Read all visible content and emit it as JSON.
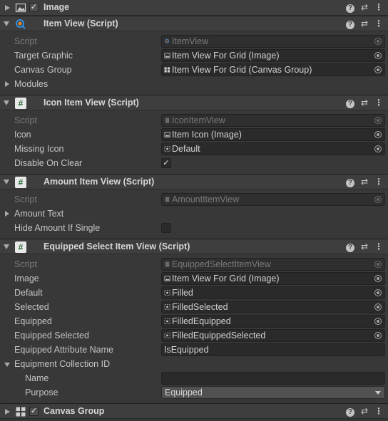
{
  "components": [
    {
      "title": "Image",
      "icon": "image-icon",
      "collapsed": true,
      "enabled": true
    },
    {
      "title": "Item View (Script)",
      "icon": "search-script-icon"
    },
    {
      "title": "Icon Item View (Script)",
      "icon": "script-icon"
    },
    {
      "title": "Amount Item View (Script)",
      "icon": "script-icon"
    },
    {
      "title": "Equipped Select Item View (Script)",
      "icon": "script-icon"
    },
    {
      "title": "Canvas Group",
      "icon": "canvas-group-icon",
      "collapsed": true,
      "enabled": true
    }
  ],
  "item_view": {
    "script_label": "Script",
    "script_value": "ItemView",
    "target_graphic_label": "Target Graphic",
    "target_graphic_value": "Item View For Grid (Image)",
    "canvas_group_label": "Canvas Group",
    "canvas_group_value": "Item View For Grid (Canvas Group)",
    "modules_label": "Modules"
  },
  "icon_item_view": {
    "script_label": "Script",
    "script_value": "IconItemView",
    "icon_label": "Icon",
    "icon_value": "Item Icon (Image)",
    "missing_icon_label": "Missing Icon",
    "missing_icon_value": "Default",
    "disable_on_clear_label": "Disable On Clear",
    "disable_on_clear_checked": true
  },
  "amount_item_view": {
    "script_label": "Script",
    "script_value": "AmountItemView",
    "amount_text_label": "Amount Text",
    "hide_amount_label": "Hide Amount If Single",
    "hide_amount_checked": false
  },
  "equipped_select_item_view": {
    "script_label": "Script",
    "script_value": "EquippedSelectItemView",
    "image_label": "Image",
    "image_value": "Item View For Grid (Image)",
    "default_label": "Default",
    "default_value": "Filled",
    "selected_label": "Selected",
    "selected_value": "FilledSelected",
    "equipped_label": "Equipped",
    "equipped_value": "FilledEquipped",
    "equipped_selected_label": "Equipped Selected",
    "equipped_selected_value": "FilledEquippedSelected",
    "equipped_attr_label": "Equipped Attribute Name",
    "equipped_attr_value": "IsEquipped",
    "collection_id_label": "Equipment Collection ID",
    "name_label": "Name",
    "name_value": "",
    "purpose_label": "Purpose",
    "purpose_value": "Equipped"
  },
  "checkmark": "✓",
  "colors": {
    "background": "#383838",
    "header": "#3e3e3e",
    "field": "#2a2a2a",
    "text": "#c4c4c4"
  }
}
